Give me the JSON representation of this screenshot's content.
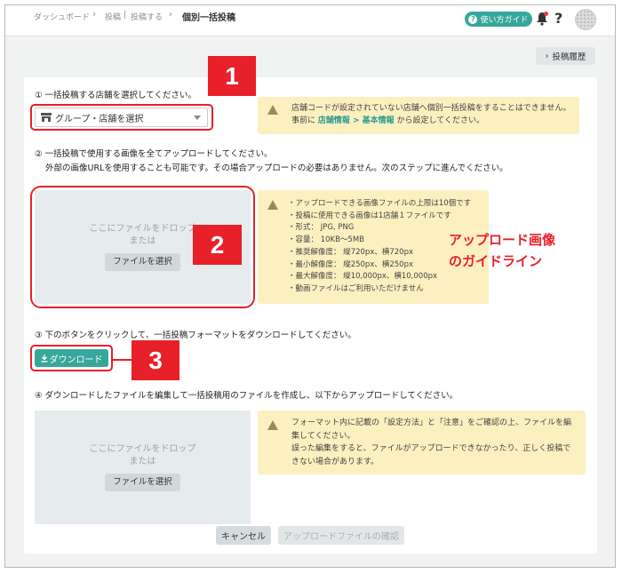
{
  "breadcrumb": {
    "dashboard": "ダッシュボード",
    "post": "投稿",
    "posting": "投稿する",
    "current": "個別一括投稿"
  },
  "header": {
    "guide_label": "使い方ガイド",
    "help": "?"
  },
  "history_label": "投稿履歴",
  "step1": {
    "label": "① 一括投稿する店舗を選択してください。",
    "select_value": "グループ・店舗を選択",
    "warning_line1": "店舗コードが設定されていない店舗へ個別一括投稿をすることはできません。",
    "warning_pre": "事前に ",
    "warning_link": "店舗情報 > 基本情報",
    "warning_post": " から設定してください。"
  },
  "step2": {
    "label_line1": "② 一括投稿で使用する画像を全てアップロードしてください。",
    "label_line2": "外部の画像URLを使用することも可能です。その場合アップロードの必要はありません。次のステップに進んでください。",
    "drop_text": "ここにファイルをドロップ",
    "drop_or": "または",
    "file_button": "ファイルを選択",
    "guidelines": [
      "・アップロードできる画像ファイルの上限は10個です",
      "・投稿に使用できる画像は1店舗１ファイルです",
      "・形式： JPG, PNG",
      "・容量： 10KB〜5MB",
      "・推奨解像度： 縦720px、横720px",
      "・最小解像度： 縦250px、横250px",
      "・最大解像度： 縦10,000px、横10,000px",
      "・動画ファイルはご利用いただけません"
    ]
  },
  "step3": {
    "label": "③ 下のボタンをクリックして、一括投稿フォーマットをダウンロードしてください。",
    "download_label": "ダウンロード"
  },
  "step4": {
    "label": "④ ダウンロードしたファイルを編集して一括投稿用のファイルを作成し、以下からアップロードしてください。",
    "drop_text": "ここにファイルをドロップ",
    "drop_or": "または",
    "file_button": "ファイルを選択",
    "warning_lines": [
      "フォーマット内に記載の「設定方法」と「注意」をご確認の上、ファイルを編",
      "集してください。",
      "誤った編集をすると、ファイルがアップロードできなかったり、正しく投稿で",
      "きない場合があります。"
    ]
  },
  "footer": {
    "cancel_label": "キャンセル",
    "confirm_label": "アップロードファイルの確認"
  },
  "annotations": {
    "callout1": "1",
    "callout2": "2",
    "callout3": "3",
    "note_line1": "アップロード画像",
    "note_line2": "のガイドライン"
  },
  "colors": {
    "accent": "#36a79b",
    "warning_bg": "#fdf0c0",
    "annotation_red": "#e8202a"
  }
}
